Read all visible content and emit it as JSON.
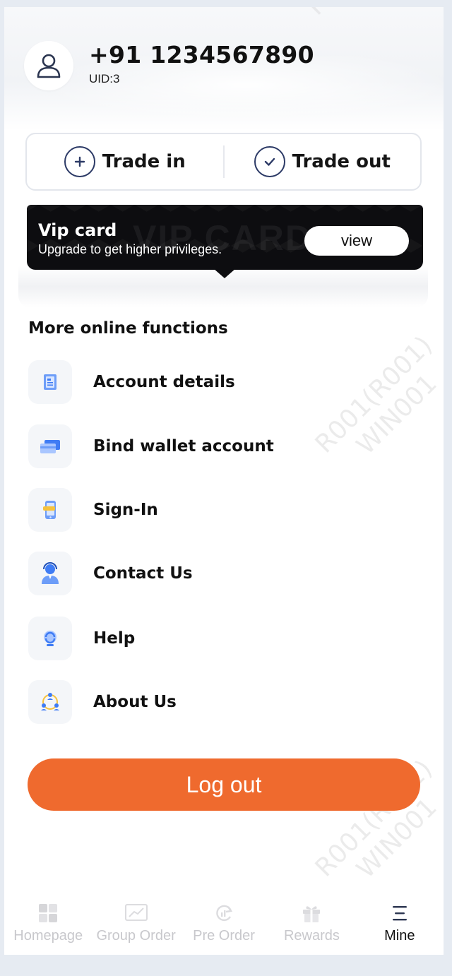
{
  "profile": {
    "phone": "+91 1234567890",
    "uid": "UID:3",
    "icon": "user-icon"
  },
  "trade": {
    "trade_in_label": "Trade in",
    "trade_in_icon": "plus-circle-icon",
    "trade_out_label": "Trade out",
    "trade_out_icon": "check-circle-icon"
  },
  "vip": {
    "title": "Vip card",
    "subtitle": "Upgrade to get higher privileges.",
    "background_text": "VIP CARD",
    "button_label": "view"
  },
  "functions": {
    "title": "More online functions",
    "items": [
      {
        "label": "Account details",
        "icon": "document-icon"
      },
      {
        "label": "Bind wallet account",
        "icon": "card-icon"
      },
      {
        "label": "Sign-In",
        "icon": "phone-icon"
      },
      {
        "label": "Contact Us",
        "icon": "support-agent-icon"
      },
      {
        "label": "Help",
        "icon": "help-icon"
      },
      {
        "label": "About Us",
        "icon": "people-network-icon"
      }
    ]
  },
  "logout_label": "Log out",
  "watermark": {
    "line1": "R001(R001)",
    "line2": "WIN001"
  },
  "tabbar": {
    "items": [
      {
        "label": "Homepage",
        "icon": "home-grid-icon",
        "active": false
      },
      {
        "label": "Group Order",
        "icon": "chart-icon",
        "active": false
      },
      {
        "label": "Pre Order",
        "icon": "refresh-icon",
        "active": false
      },
      {
        "label": "Rewards",
        "icon": "gift-icon",
        "active": false
      },
      {
        "label": "Mine",
        "icon": "menu-icon",
        "active": true
      }
    ]
  },
  "colors": {
    "accent": "#ef6a2e",
    "vip_bg": "#0d0d10",
    "icon_blue": "#3f7cf4"
  }
}
